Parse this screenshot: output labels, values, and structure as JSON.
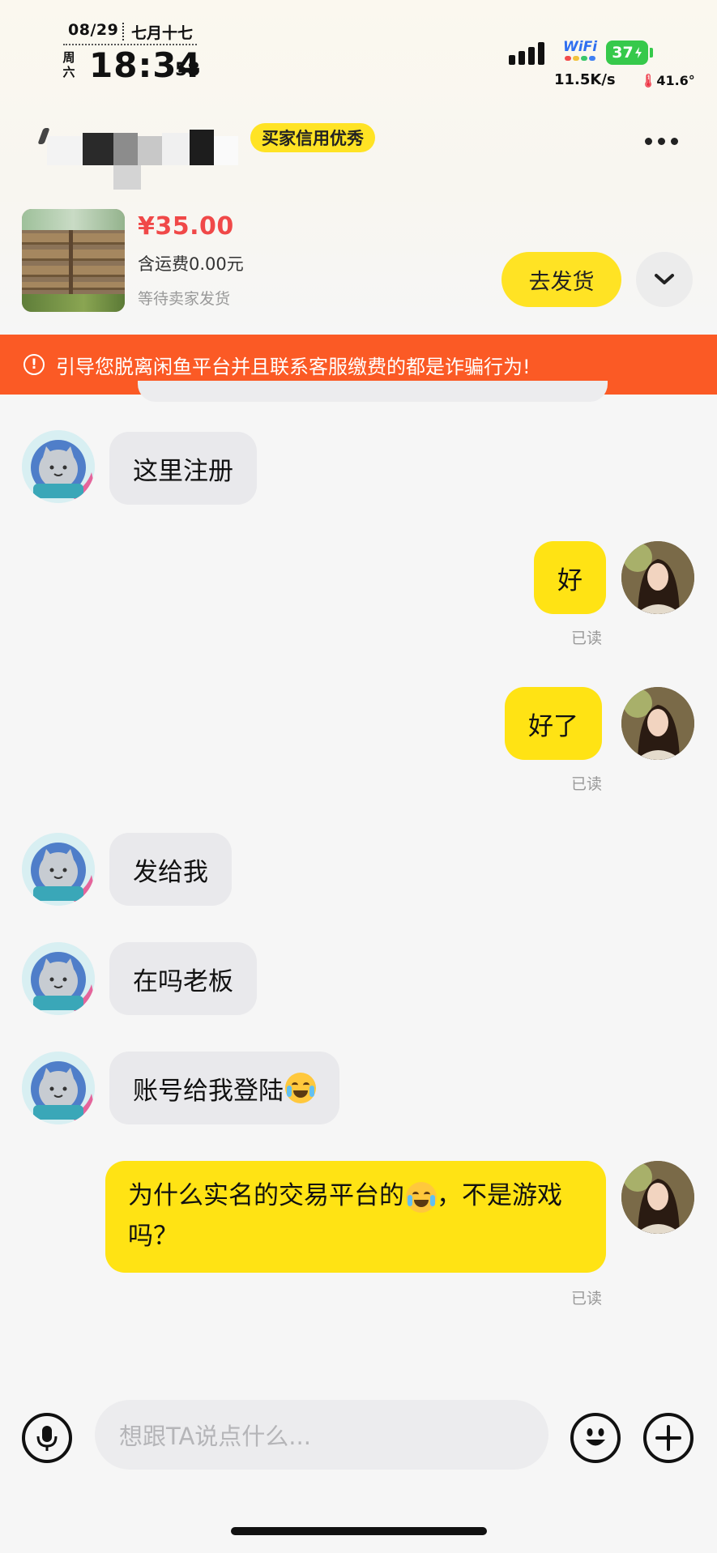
{
  "status_bar": {
    "date": "08/29",
    "lunar_date": "七月十七",
    "weekday": "周六",
    "time": "18:34",
    "seconds": "58",
    "wifi_label": "WiFi",
    "battery": "37",
    "net_speed": "11.5K/s",
    "temperature": "41.6°"
  },
  "header": {
    "badge": "买家信用优秀",
    "more_icon": "more-icon"
  },
  "product": {
    "price": "¥35.00",
    "shipping": "含运费0.00元",
    "status": "等待卖家发货",
    "ship_button": "去发货",
    "expand_icon": "chevron-down-icon"
  },
  "warning": {
    "text": "引导您脱离闲鱼平台并且联系客服缴费的都是诈骗行为!",
    "icon": "alert-circle-icon"
  },
  "messages": [
    {
      "from": "other",
      "text": "这里注册"
    },
    {
      "from": "me",
      "text": "好",
      "status": "已读"
    },
    {
      "from": "me",
      "text": "好了",
      "status": "已读"
    },
    {
      "from": "other",
      "text": "发给我"
    },
    {
      "from": "other",
      "text": "在吗老板"
    },
    {
      "from": "other",
      "text": "账号给我登陆",
      "emoji": "laughing-tears-emoji"
    },
    {
      "from": "me",
      "text_before": "为什么实名的交易平台的",
      "text_after": "，不是游戏吗？",
      "emoji": "crying-laugh-emoji",
      "status": "已读"
    }
  ],
  "composer": {
    "placeholder": "想跟TA说点什么...",
    "voice_icon": "microphone-icon",
    "emoji_icon": "smiley-icon",
    "plus_icon": "plus-icon"
  },
  "colors": {
    "accent_yellow": "#ffe314",
    "price_red": "#f04848",
    "warning_orange": "#fb5a25",
    "battery_green": "#36c94b"
  }
}
